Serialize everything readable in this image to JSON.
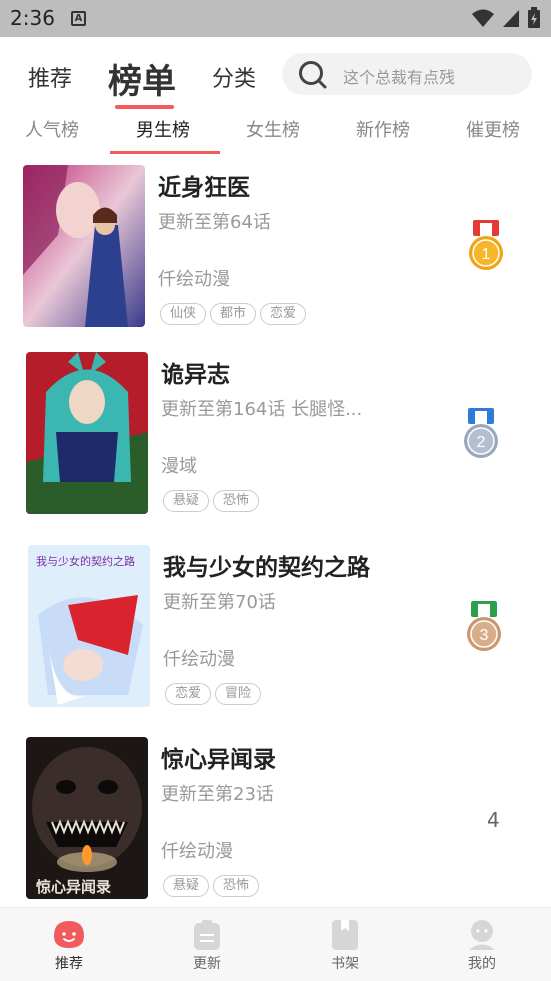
{
  "status": {
    "time": "2:36"
  },
  "header": {
    "tabs": [
      "推荐",
      "榜单",
      "分类"
    ],
    "active_tab": "榜单",
    "search_placeholder": "这个总裁有点残"
  },
  "subtabs": [
    "人气榜",
    "男生榜",
    "女生榜",
    "新作榜",
    "催更榜"
  ],
  "active_subtab": "男生榜",
  "items": [
    {
      "title": "近身狂医",
      "update": "更新至第64话",
      "author": "仟绘动漫",
      "tags": [
        "仙侠",
        "都市",
        "恋爱"
      ],
      "rank": 1,
      "medal": "gold"
    },
    {
      "title": "诡异志",
      "update": "更新至第164话 长腿怪...",
      "author": "漫域",
      "tags": [
        "悬疑",
        "恐怖"
      ],
      "rank": 2,
      "medal": "silver"
    },
    {
      "title": "我与少女的契约之路",
      "update": "更新至第70话",
      "author": "仟绘动漫",
      "tags": [
        "恋爱",
        "冒险"
      ],
      "rank": 3,
      "medal": "bronze"
    },
    {
      "title": "惊心异闻录",
      "update": "更新至第23话",
      "author": "仟绘动漫",
      "tags": [
        "悬疑",
        "恐怖"
      ],
      "rank": "4"
    }
  ],
  "cover_text": {
    "item2": "我与少女的契约之路",
    "item3": "惊心异闻录"
  },
  "bottom_nav": [
    {
      "label": "推荐",
      "icon": "smile-icon",
      "active": true
    },
    {
      "label": "更新",
      "icon": "update-list-icon",
      "active": false
    },
    {
      "label": "书架",
      "icon": "bookshelf-icon",
      "active": false
    },
    {
      "label": "我的",
      "icon": "user-icon",
      "active": false
    }
  ],
  "colors": {
    "accent": "#f25b5b",
    "gold": "#f2a417",
    "silver": "#9aa8bd",
    "bronze": "#c99a72"
  }
}
